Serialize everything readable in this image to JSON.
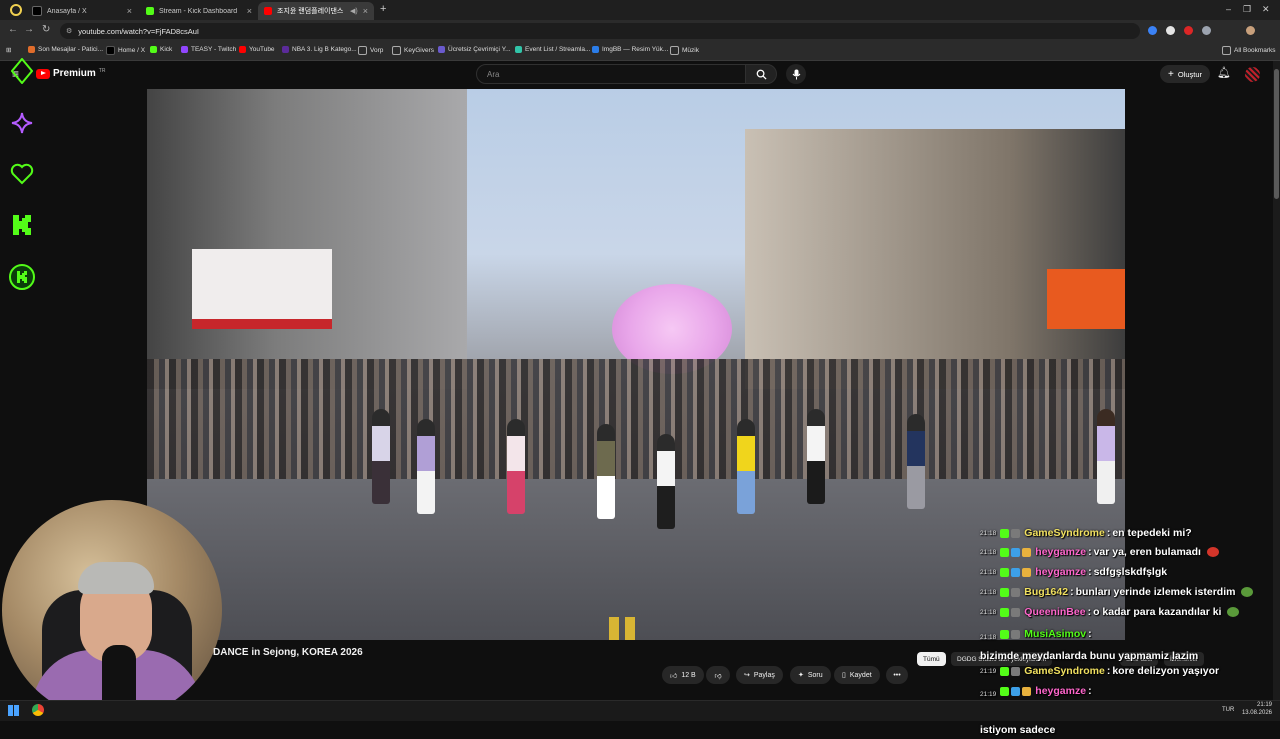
{
  "browser": {
    "tabs": [
      {
        "title": "Anasayfa / X",
        "active": false,
        "favicon_color": "#000000"
      },
      {
        "title": "Stream - Kick Dashboard",
        "active": false,
        "favicon_color": "#53fc18"
      },
      {
        "title": "조지윤 랜덤플레이댄스 KI...",
        "active": true,
        "favicon_color": "#ff0000"
      }
    ],
    "new_tab_label": "+",
    "url": "youtube.com/watch?v=FjFAD8csAuI",
    "bookmarks": [
      {
        "label": "Son Mesajlar - Patici...",
        "color": "#e06c2b"
      },
      {
        "label": "Home / X",
        "color": "#000000"
      },
      {
        "label": "Kick",
        "color": "#53fc18"
      },
      {
        "label": "TEASY - Twitch",
        "color": "#9146ff"
      },
      {
        "label": "YouTube",
        "color": "#ff0000"
      },
      {
        "label": "NBA 3. Lig B Katego...",
        "color": "#5b2b9a"
      },
      {
        "label": "Vorp",
        "color": "#777777"
      },
      {
        "label": "KeyGivers",
        "color": "#777777"
      },
      {
        "label": "Ücretsiz Çevrimiçi Y...",
        "color": "#6a5acd"
      },
      {
        "label": "Event List / Streamla...",
        "color": "#31c4a8"
      },
      {
        "label": "ImgBB — Resim Yük...",
        "color": "#2b7de9"
      },
      {
        "label": "Müzik",
        "color": "#777777"
      }
    ],
    "all_bookmarks_label": "All Bookmarks"
  },
  "youtube": {
    "logo_text": "Premium",
    "logo_region": "TR",
    "search_placeholder": "Ara",
    "create_label": "Oluştur",
    "video_title": "DANCE in Sejong, KOREA 2026",
    "actions": {
      "like_count": "12 B",
      "share_label": "Paylaş",
      "ask_label": "Soru",
      "save_label": "Kaydet",
      "more_label": "•••"
    },
    "chips": [
      {
        "label": "Tümü",
        "selected": true
      },
      {
        "label": "DGDG Studio adlı yükleyiciden",
        "selected": false
      },
      {
        "label": "Size özel",
        "selected": false
      },
      {
        "label": "İzlenenler",
        "selected": false
      }
    ]
  },
  "chat": {
    "messages": [
      {
        "time": "21:18",
        "user": "GameSyndrome",
        "user_color": "#f0e060",
        "text": "en tepedeki mi?"
      },
      {
        "time": "21:18",
        "user": "heygamze",
        "user_color": "#ff66cc",
        "text": "var ya, eren bulamadı"
      },
      {
        "time": "21:18",
        "user": "heygamze",
        "user_color": "#ff66cc",
        "text": "sdfgşlskdfşlgk"
      },
      {
        "time": "21:18",
        "user": "Bug1642",
        "user_color": "#f0e060",
        "text": "bunları yerinde izlemek isterdim"
      },
      {
        "time": "21:18",
        "user": "QueeninBee",
        "user_color": "#ff66cc",
        "text": "o kadar para kazandılar ki"
      },
      {
        "time": "21:18",
        "user": "MusiAsimov",
        "user_color": "#53fc18",
        "text": "bizimde meydanlarda bunu yapmamiz lazim"
      },
      {
        "time": "21:19",
        "user": "GameSyndrome",
        "user_color": "#f0e060",
        "text": "kore delizyon yaşıyor"
      },
      {
        "time": "21:19",
        "user": "heygamze",
        "user_color": "#ff66cc",
        "text": "yok dostum ben mahallede döner bıçaklı adam görmek istiyom sadece"
      }
    ]
  },
  "taskbar": {
    "lang": "TUR",
    "time": "21:19",
    "date": "13.08.2026"
  }
}
